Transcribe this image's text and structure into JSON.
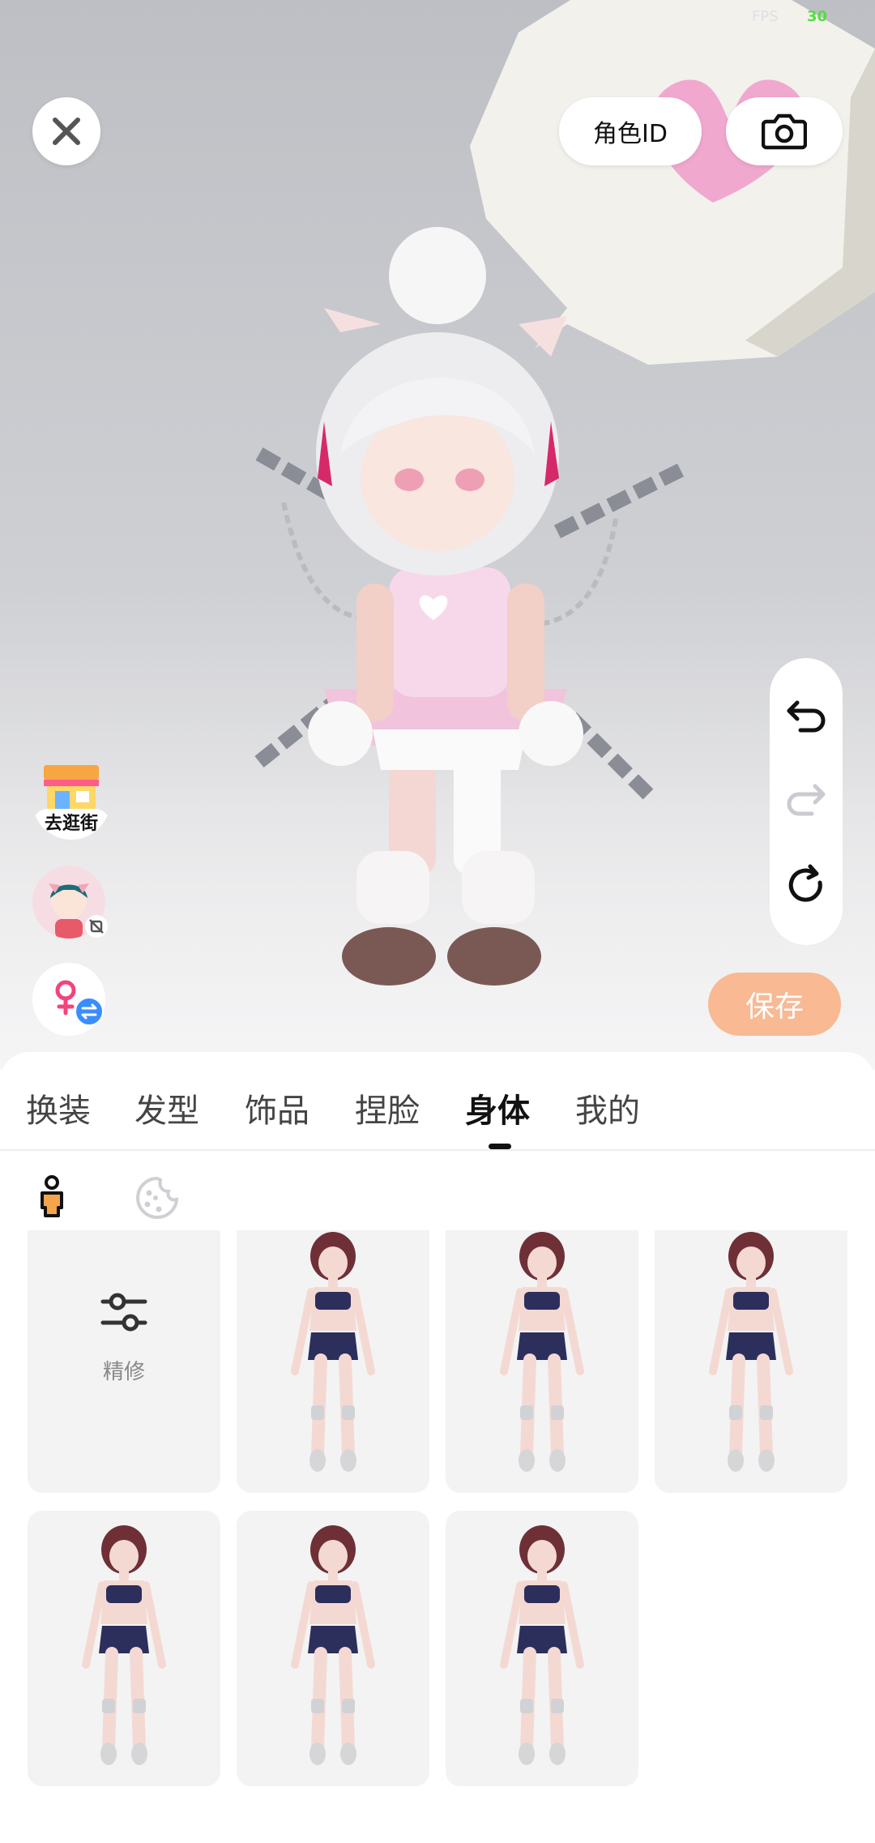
{
  "fps": {
    "label": "FPS",
    "value": "30"
  },
  "header": {
    "role_id_label": "角色ID"
  },
  "actions": {
    "save_label": "保存"
  },
  "side": {
    "shop_label": "去逛街"
  },
  "tabs": [
    {
      "label": "换装"
    },
    {
      "label": "发型"
    },
    {
      "label": "饰品"
    },
    {
      "label": "捏脸"
    },
    {
      "label": "身体",
      "active": true
    },
    {
      "label": "我的"
    }
  ],
  "subtabs": [
    {
      "icon": "body-shape-icon",
      "selected": true
    },
    {
      "icon": "skin-palette-icon",
      "selected": false
    }
  ],
  "grid": {
    "refine_label": "精修",
    "body_presets": 6
  },
  "colors": {
    "save": "#f8b993",
    "card_bg": "#f3f3f4",
    "active_tab": "#111111"
  }
}
